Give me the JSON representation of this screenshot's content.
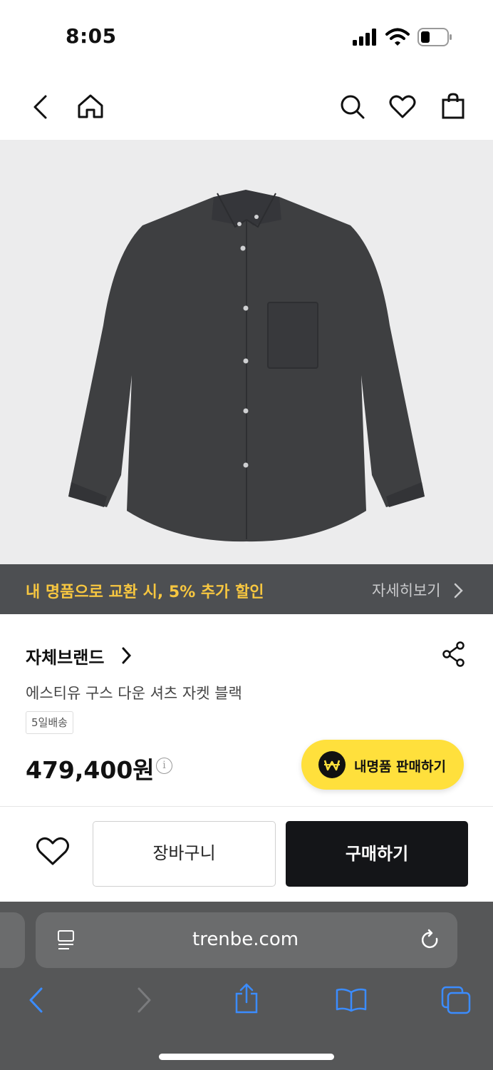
{
  "status_bar": {
    "time": "8:05"
  },
  "product": {
    "brand": "자체브랜드",
    "name": "에스티유 구스 다운 셔츠 자켓 블랙",
    "shipping_badge": "5일배송",
    "price": "479,400원"
  },
  "promo": {
    "text": "내 명품으로 교환 시, 5% 추가 할인",
    "more": "자세히보기"
  },
  "sell_button": {
    "label": "내명품 판매하기"
  },
  "actions": {
    "cart": "장바구니",
    "buy": "구매하기"
  },
  "browser": {
    "url": "trenbe.com"
  },
  "colors": {
    "promo_text": "#f6c640",
    "sell_button": "#ffe03c",
    "buy_button": "#141518"
  },
  "icons": [
    "back-icon",
    "home-icon",
    "search-icon",
    "heart-icon",
    "shopping-bag-icon",
    "chevron-right-icon",
    "share-icon",
    "info-icon",
    "won-icon",
    "reader-icon",
    "reload-icon",
    "share-up-icon",
    "book-icon",
    "tabs-icon"
  ]
}
